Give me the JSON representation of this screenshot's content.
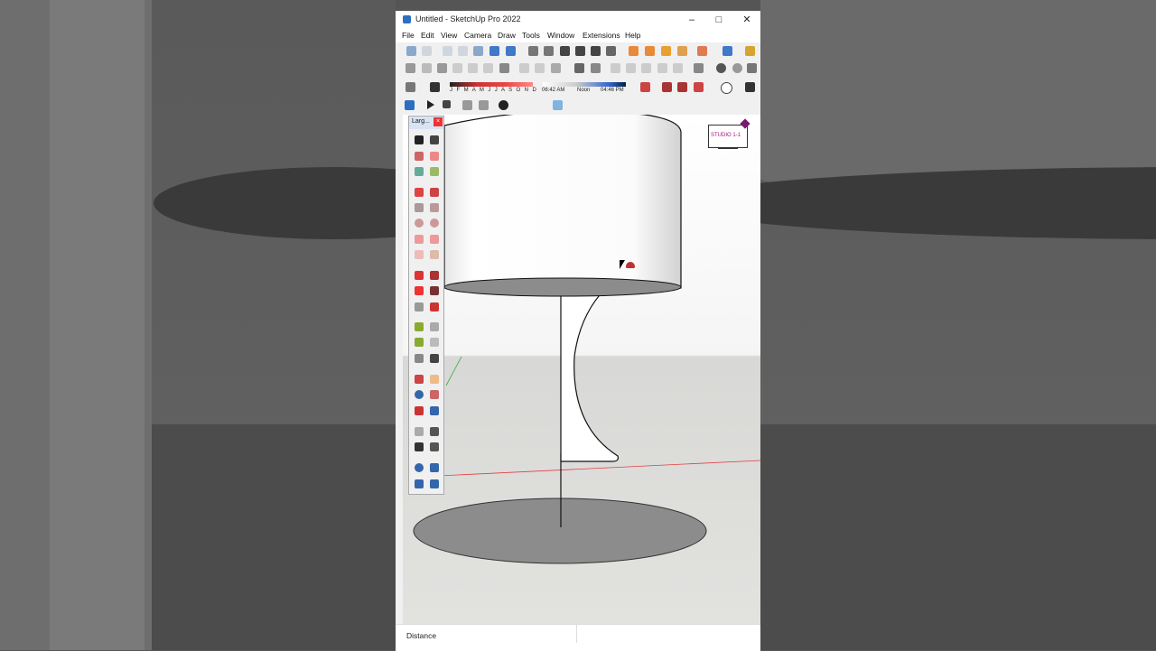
{
  "window": {
    "title": "Untitled - SketchUp Pro 2022",
    "minimize_glyph": "–",
    "maximize_glyph": "□",
    "close_glyph": "✕"
  },
  "menu": [
    "File",
    "Edit",
    "View",
    "Camera",
    "Draw",
    "Tools",
    "Window",
    "Extensions",
    "Help"
  ],
  "shadows": {
    "months": "J F M A M J J A S O N D",
    "time_start": "06:42 AM",
    "time_noon": "Noon",
    "time_end": "04:46 PM"
  },
  "palette": {
    "title": "Larg...",
    "close_glyph": "×"
  },
  "logo_text": "STUDIO 1-1",
  "status": {
    "label": "Distance"
  },
  "colors": {
    "accent": "#2b6fc1",
    "axis_red": "#e04040",
    "axis_green": "#40b040",
    "model_shadow": "#8c8c8c"
  }
}
